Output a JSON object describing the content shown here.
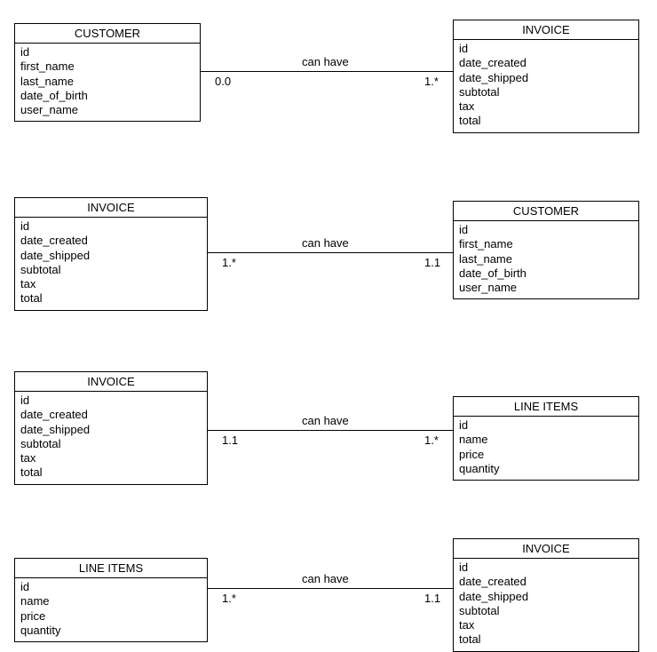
{
  "entities": {
    "customer": {
      "title": "CUSTOMER",
      "attrs": [
        "id",
        "first_name",
        "last_name",
        "date_of_birth",
        "user_name"
      ]
    },
    "invoice": {
      "title": "INVOICE",
      "attrs": [
        "id",
        "date_created",
        "date_shipped",
        "subtotal",
        "tax",
        "total"
      ]
    },
    "lineitems": {
      "title": "LINE ITEMS",
      "attrs": [
        "id",
        "name",
        "price",
        "quantity"
      ]
    }
  },
  "relationships": [
    {
      "label": "can have",
      "left_mult": "0.0",
      "right_mult": "1.*"
    },
    {
      "label": "can have",
      "left_mult": "1.*",
      "right_mult": "1.1"
    },
    {
      "label": "can have",
      "left_mult": "1.1",
      "right_mult": "1.*"
    },
    {
      "label": "can have",
      "left_mult": "1.*",
      "right_mult": "1.1"
    }
  ]
}
